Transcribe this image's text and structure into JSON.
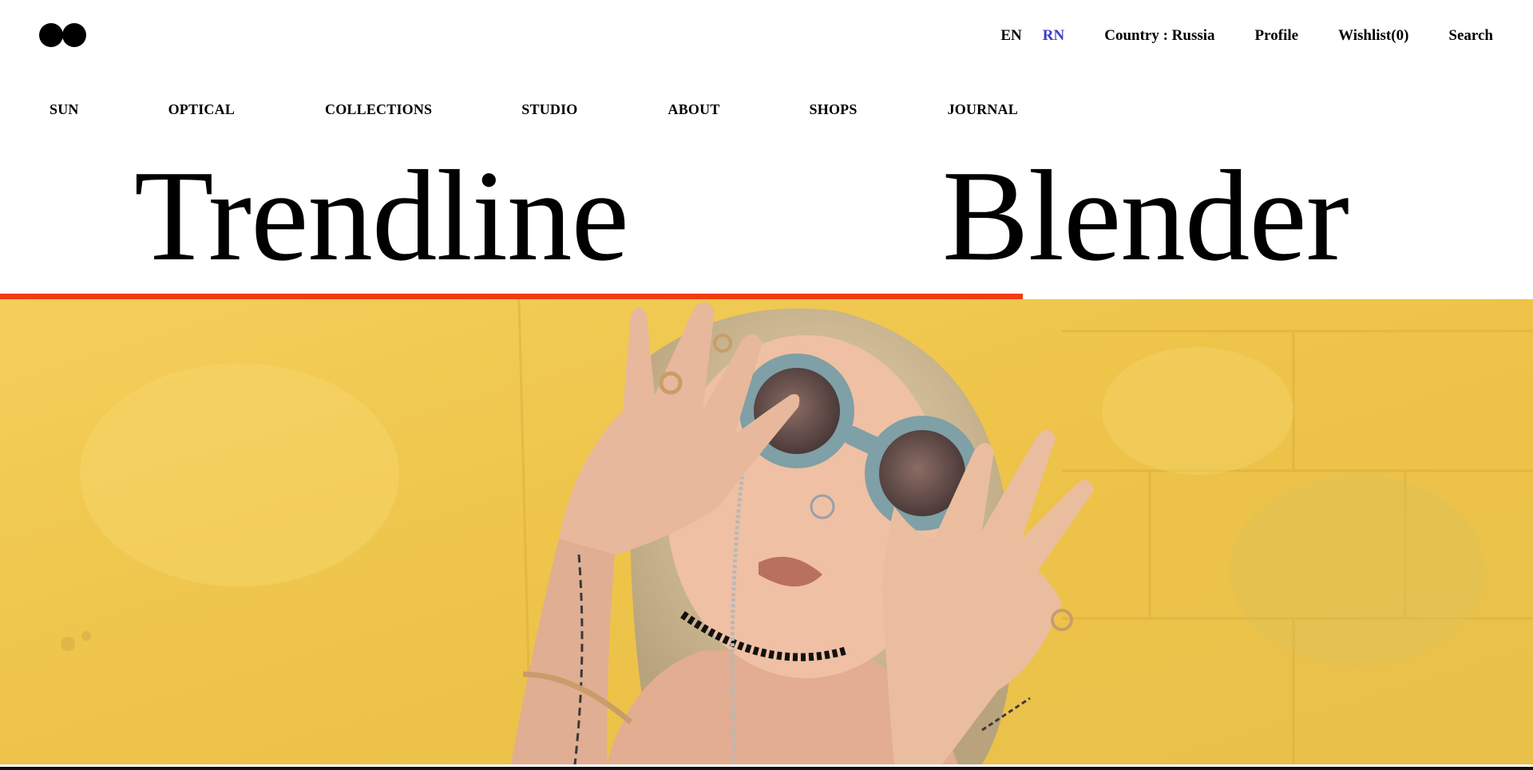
{
  "header": {
    "logo_name": "logo-glasses-icon",
    "languages": [
      "EN",
      "RN"
    ],
    "active_language": "RN",
    "country": "Country : Russia",
    "profile": "Profile",
    "wishlist": "Wishlist(0)",
    "search": "Search"
  },
  "nav": {
    "items": [
      "SUN",
      "OPTICAL",
      "COLLECTIONS",
      "STUDIO",
      "ABOUT",
      "SHOPS",
      "JOURNAL"
    ]
  },
  "hero": {
    "title_words": [
      "Trendline",
      "Blender"
    ],
    "progress": 0.667
  },
  "colors": {
    "accent": "#f03c0f",
    "active_lang": "#3c3cc8",
    "hero_bg": "#f0c94a"
  }
}
